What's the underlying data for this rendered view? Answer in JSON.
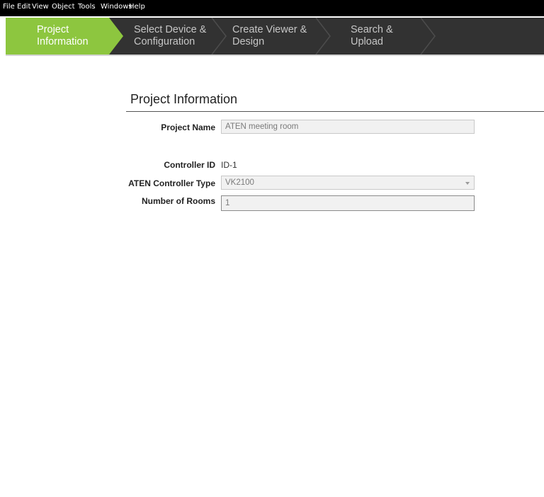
{
  "menu": [
    "File",
    "Edit",
    "View",
    "Object",
    "Tools",
    "Windows",
    "Help"
  ],
  "steps": [
    {
      "label": "Project\nInformation"
    },
    {
      "label": "Select Device &\nConfiguration"
    },
    {
      "label": "Create Viewer &\nDesign"
    },
    {
      "label": "Search &\nUpload"
    }
  ],
  "colors": {
    "active_step": "#8dc63f",
    "stepbar": "#323232"
  },
  "section": {
    "title": "Project Information"
  },
  "form": {
    "project_name": {
      "label": "Project Name",
      "value": "ATEN meeting room"
    },
    "controller_id": {
      "label": "Controller ID",
      "value": "ID-1"
    },
    "controller_type": {
      "label": "ATEN Controller Type",
      "value": "VK2100"
    },
    "rooms": {
      "label": "Number of Rooms",
      "value": "1"
    }
  }
}
